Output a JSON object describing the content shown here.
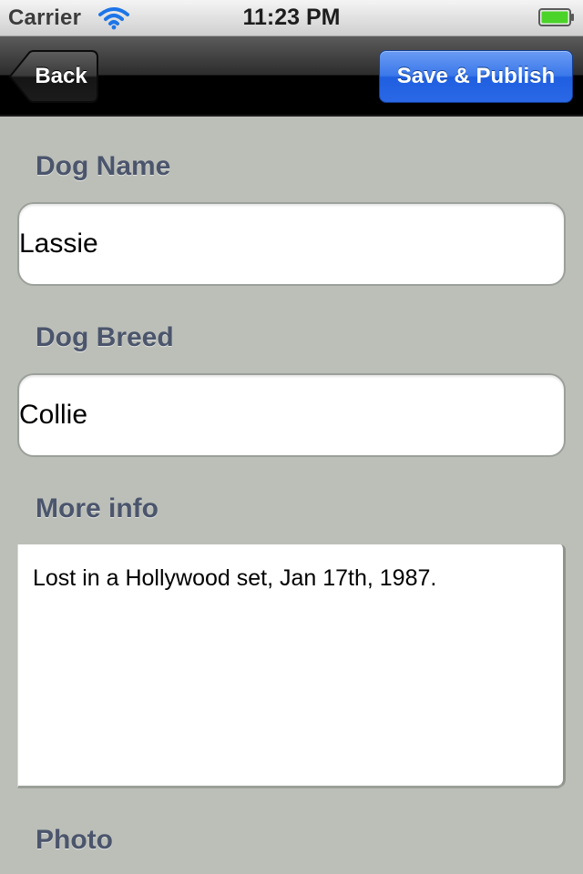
{
  "status_bar": {
    "carrier": "Carrier",
    "time": "11:23 PM"
  },
  "nav": {
    "back_label": "Back",
    "publish_label": "Save & Publish"
  },
  "form": {
    "dog_name_label": "Dog Name",
    "dog_name_value": "Lassie",
    "dog_breed_label": "Dog Breed",
    "dog_breed_value": "Collie",
    "more_info_label": "More info",
    "more_info_value": "Lost in a Hollywood set, Jan 17th, 1987.",
    "photo_label": "Photo"
  },
  "colors": {
    "background": "#bcbfb8",
    "label": "#4b556c",
    "accent_button": "#2a68e6",
    "battery": "#4cd32a"
  },
  "icons": {
    "wifi": "wifi-icon",
    "battery": "battery-icon",
    "back": "back-arrow-button"
  }
}
